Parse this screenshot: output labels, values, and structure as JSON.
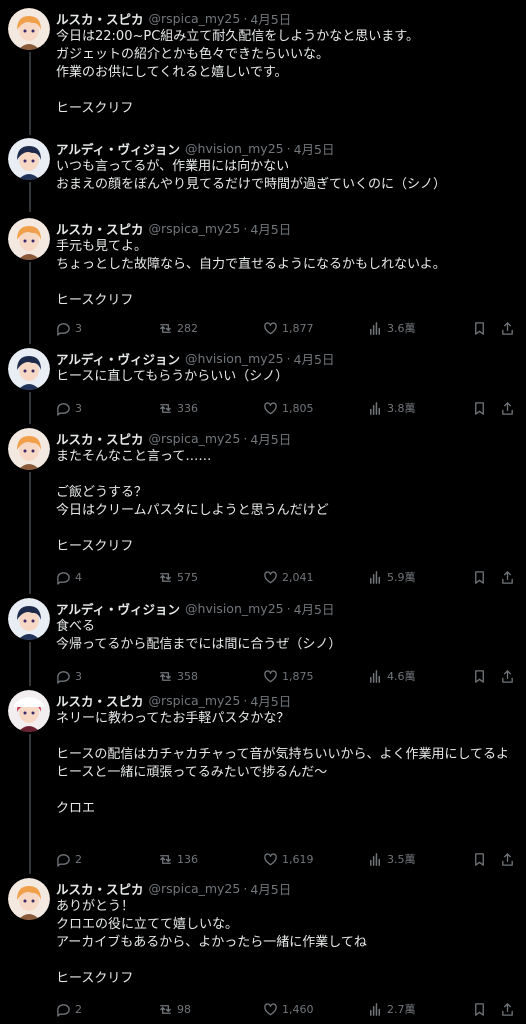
{
  "tweets": [
    {
      "name": "ルスカ・スピカ",
      "handle": "@rspica_my25",
      "date": "4月5日",
      "body": "今日は22:00~PC組み立て耐久配信をしようかなと思います。\nガジェットの紹介とかも色々できたらいいな。\n作業のお供にしてくれると嬉しいです。\n\nヒースクリフ",
      "avatar": "orange-hair"
    },
    {
      "name": "アルディ・ヴィジョン",
      "handle": "@hvision_my25",
      "date": "4月5日",
      "body": "いつも言ってるが、作業用には向かない\nおまえの顔をぼんやり見てるだけで時間が過ぎていくのに（シノ）",
      "avatar": "dark-hair"
    },
    {
      "name": "ルスカ・スピカ",
      "handle": "@rspica_my25",
      "date": "4月5日",
      "body": "手元も見てよ。\nちょっとした故障なら、自力で直せるようになるかもしれないよ。\n\nヒースクリフ",
      "replies": "3",
      "retweets": "282",
      "likes": "1,877",
      "views": "3.6萬",
      "avatar": "orange-hair"
    },
    {
      "name": "アルディ・ヴィジョン",
      "handle": "@hvision_my25",
      "date": "4月5日",
      "body": "ヒースに直してもらうからいい（シノ）",
      "replies": "3",
      "retweets": "336",
      "likes": "1,805",
      "views": "3.8萬",
      "avatar": "dark-hair"
    },
    {
      "name": "ルスカ・スピカ",
      "handle": "@rspica_my25",
      "date": "4月5日",
      "body": "またそんなこと言って……\n\nご飯どうする？\n今日はクリームパスタにしようと思うんだけど\n\nヒースクリフ",
      "replies": "4",
      "retweets": "575",
      "likes": "2,041",
      "views": "5.9萬",
      "avatar": "orange-hair"
    },
    {
      "name": "アルディ・ヴィジョン",
      "handle": "@hvision_my25",
      "date": "4月5日",
      "body": "食べる\n今帰ってるから配信までには間に合うぜ（シノ）",
      "replies": "3",
      "retweets": "358",
      "likes": "1,875",
      "views": "4.6萬",
      "avatar": "dark-hair"
    },
    {
      "name": "ルスカ・スピカ",
      "handle": "@rspica_my25",
      "date": "4月5日",
      "body": "ネリーに教わってたお手軽パスタかな？\n\nヒースの配信はカチャカチャって音が気持ちいいから、よく作業用にしてるよ\nヒースと一緒に頑張ってるみたいで捗るんだ〜\n\nクロエ",
      "replies": "2",
      "retweets": "136",
      "likes": "1,619",
      "views": "3.5萬",
      "avatar": "red-hair"
    },
    {
      "name": "ルスカ・スピカ",
      "handle": "@rspica_my25",
      "date": "4月5日",
      "body": "ありがとう！\nクロエの役に立てて嬉しいな。\nアーカイブもあるから、よかったら一緒に作業してね\n\nヒースクリフ",
      "replies": "2",
      "retweets": "98",
      "likes": "1,460",
      "views": "2.7萬",
      "avatar": "orange-hair"
    }
  ]
}
